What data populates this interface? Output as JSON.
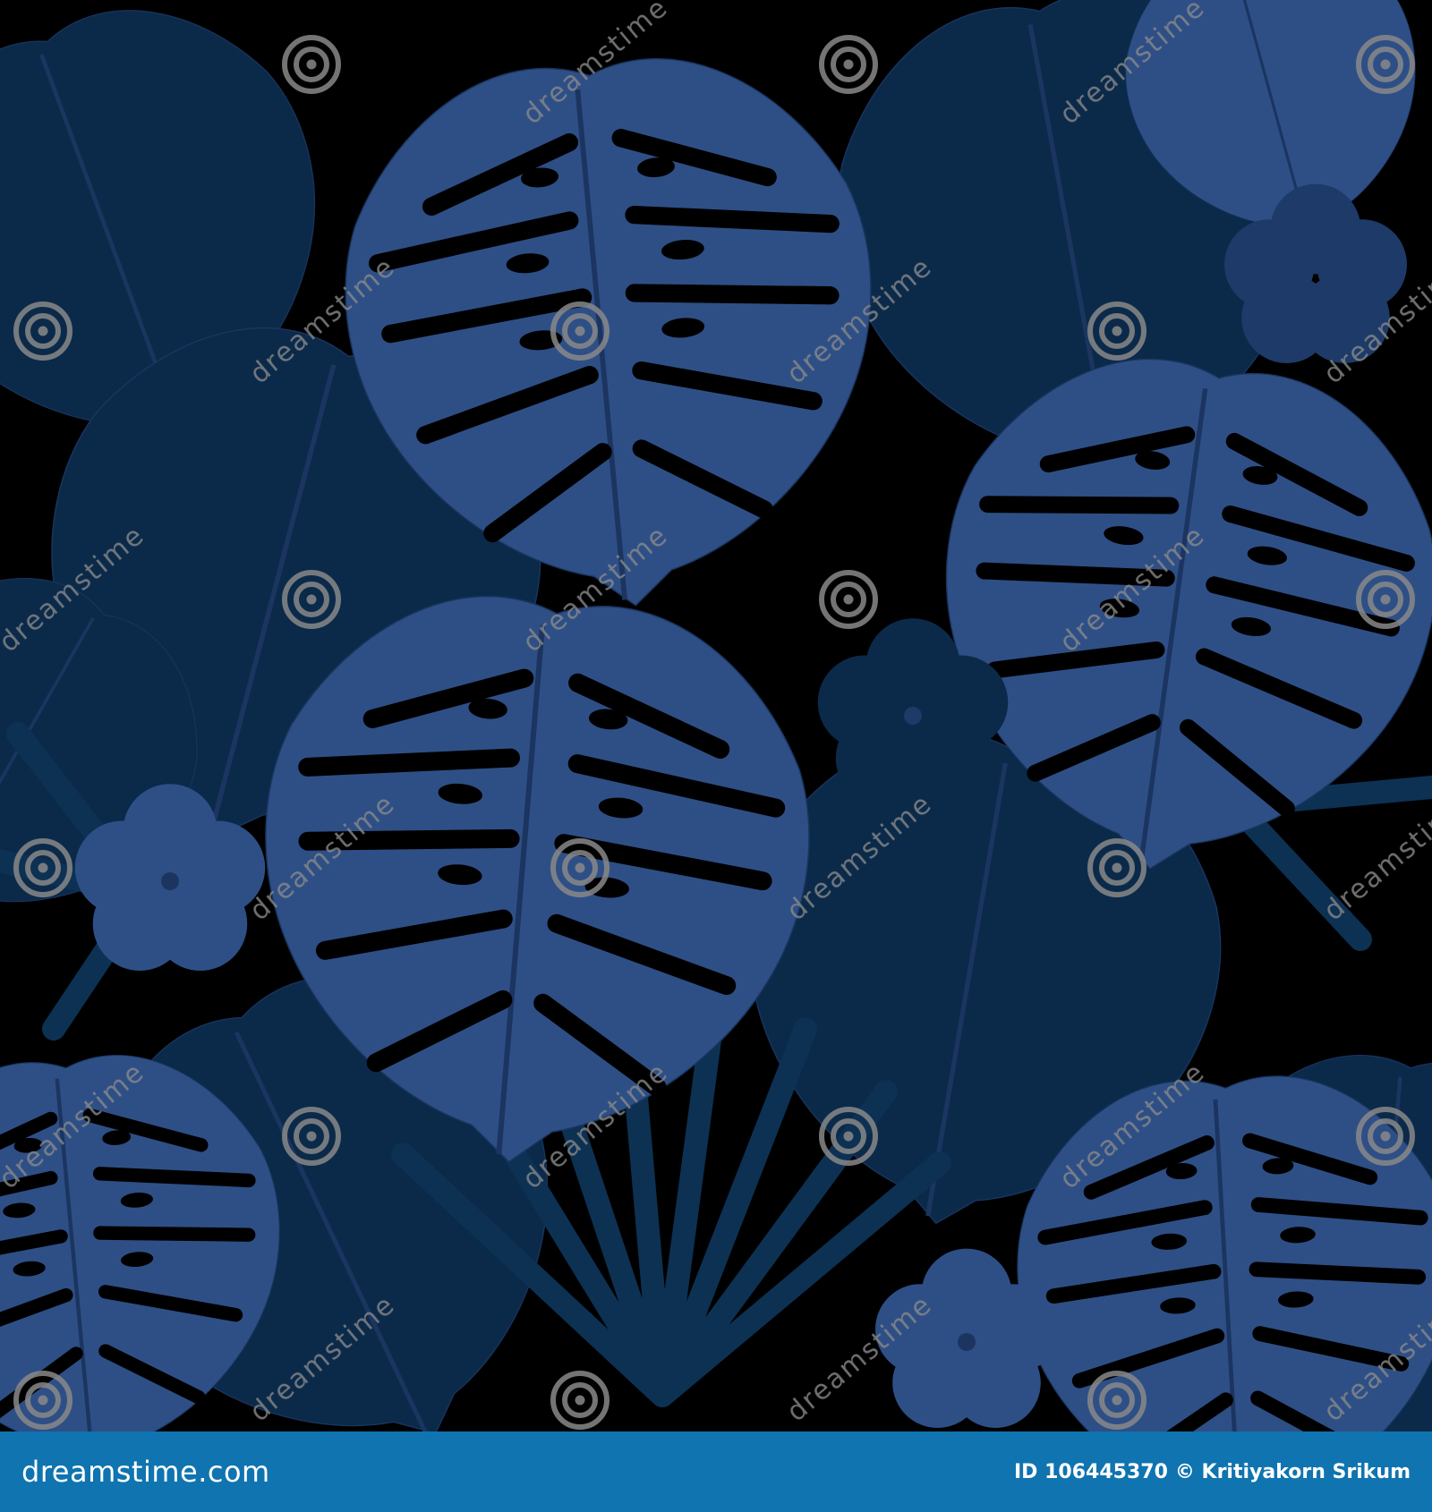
{
  "image": {
    "subject": "seamless tropical pattern",
    "palette": {
      "background": "#000000",
      "leaf_dark": "#0b2a4a",
      "leaf_mid": "#1d3a68",
      "leaf_light": "#2e4f86",
      "vein": "#1b3560",
      "watermark": "#8a8a8a"
    },
    "watermark": {
      "text": "dreamstime",
      "icon": "spiral-logo-icon"
    }
  },
  "footer": {
    "color": "#0f74b0",
    "brand": "dreamstime.com",
    "id_label": "ID 106445370",
    "copyright": "© Kritiyakorn Srikum"
  }
}
